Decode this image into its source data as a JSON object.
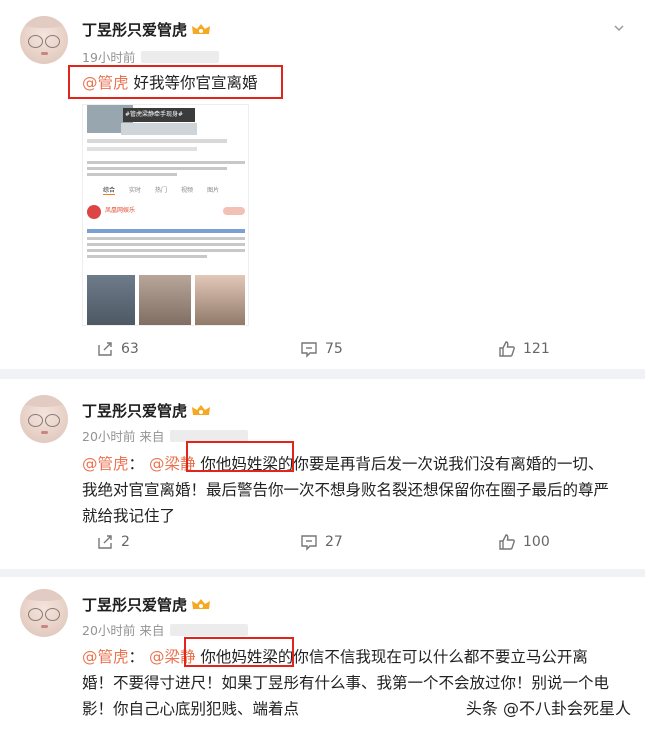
{
  "posts": [
    {
      "author": "丁昱彤只爱管虎",
      "time": "19小时前",
      "text_mention": "@管虎",
      "text_body": " 好我等你官宣离婚",
      "embedded_image": {
        "tag": "#管虎梁静牵手现身#",
        "tabs": [
          "综合",
          "实时",
          "热门",
          "视频",
          "图片"
        ],
        "account": "凤凰网娱乐"
      },
      "reposts": "63",
      "comments": "75",
      "likes": "121"
    },
    {
      "author": "丁昱彤只爱管虎",
      "time": "20小时前",
      "source_prefix": "来自",
      "mention_1": "@管虎",
      "separator": "：",
      "mention_2": "@梁静",
      "body": " 你他妈姓梁的你要是再背后发一次说我们没有离婚的一切、我绝对官宣离婚！最后警告你一次不想身败名裂还想保留你在圈子最后的尊严就给我记住了",
      "reposts": "2",
      "comments": "27",
      "likes": "100"
    },
    {
      "author": "丁昱彤只爱管虎",
      "time": "20小时前",
      "source_prefix": "来自",
      "mention_1": "@管虎",
      "separator": "：",
      "mention_2": "@梁静",
      "body": " 你他妈姓梁的你信不信我现在可以什么都不要立马公开离婚！不要得寸进尺！如果丁昱彤有什么事、我第一个不会放过你！别说一个电影！你自己心底别犯贱、端着点"
    }
  ],
  "watermark": "头条 @不八卦会死星人",
  "colors": {
    "mention": "#eb7350",
    "highlight_box": "#e1251b"
  },
  "icons": [
    "chevron-down-icon",
    "vip-crown-icon",
    "repost-icon",
    "comment-icon",
    "like-icon"
  ]
}
